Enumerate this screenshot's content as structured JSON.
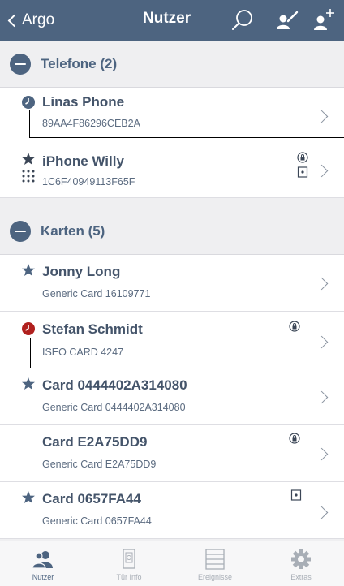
{
  "nav": {
    "back_label": "Argo",
    "title": "Nutzer"
  },
  "sections": [
    {
      "title": "Telefone (2)",
      "items": [
        {
          "title": "Linas Phone",
          "subtitle": "89AA4F86296CEB2A",
          "lead": "clock-icon"
        },
        {
          "title": "iPhone Willy",
          "subtitle": "1C6F40949113F65F",
          "lead": "star-icon",
          "extra": [
            "lock-icon",
            "door-icon"
          ]
        }
      ]
    },
    {
      "title": "Karten (5)",
      "items": [
        {
          "title": "Jonny Long",
          "subtitle": "Generic Card 16109771",
          "lead": "star-icon"
        },
        {
          "title": "Stefan Schmidt",
          "subtitle": "ISEO CARD 4247",
          "lead": "clock-icon",
          "extra": [
            "lock-icon"
          ]
        },
        {
          "title": "Card 0444402A314080",
          "subtitle": "Generic Card 0444402A314080",
          "lead": "star-icon"
        },
        {
          "title": "Card E2A75DD9",
          "subtitle": "Generic Card E2A75DD9",
          "extra": [
            "lock-icon"
          ]
        },
        {
          "title": "Card 0657FA44",
          "subtitle": "Generic Card 0657FA44",
          "lead": "star-icon",
          "extra": [
            "door-icon"
          ]
        }
      ]
    }
  ],
  "tabs": [
    {
      "label": "Nutzer",
      "icon": "users-icon",
      "active": true
    },
    {
      "label": "Tür Info",
      "icon": "door-icon",
      "active": false
    },
    {
      "label": "Ereignisse",
      "icon": "events-list-icon",
      "active": false
    },
    {
      "label": "Extras",
      "icon": "gear-icon",
      "active": false
    }
  ],
  "colors": {
    "nav_bg": "#4d6480",
    "clock_blue": "#4d6480",
    "clock_red": "#b0201e",
    "text": "#44546a"
  }
}
